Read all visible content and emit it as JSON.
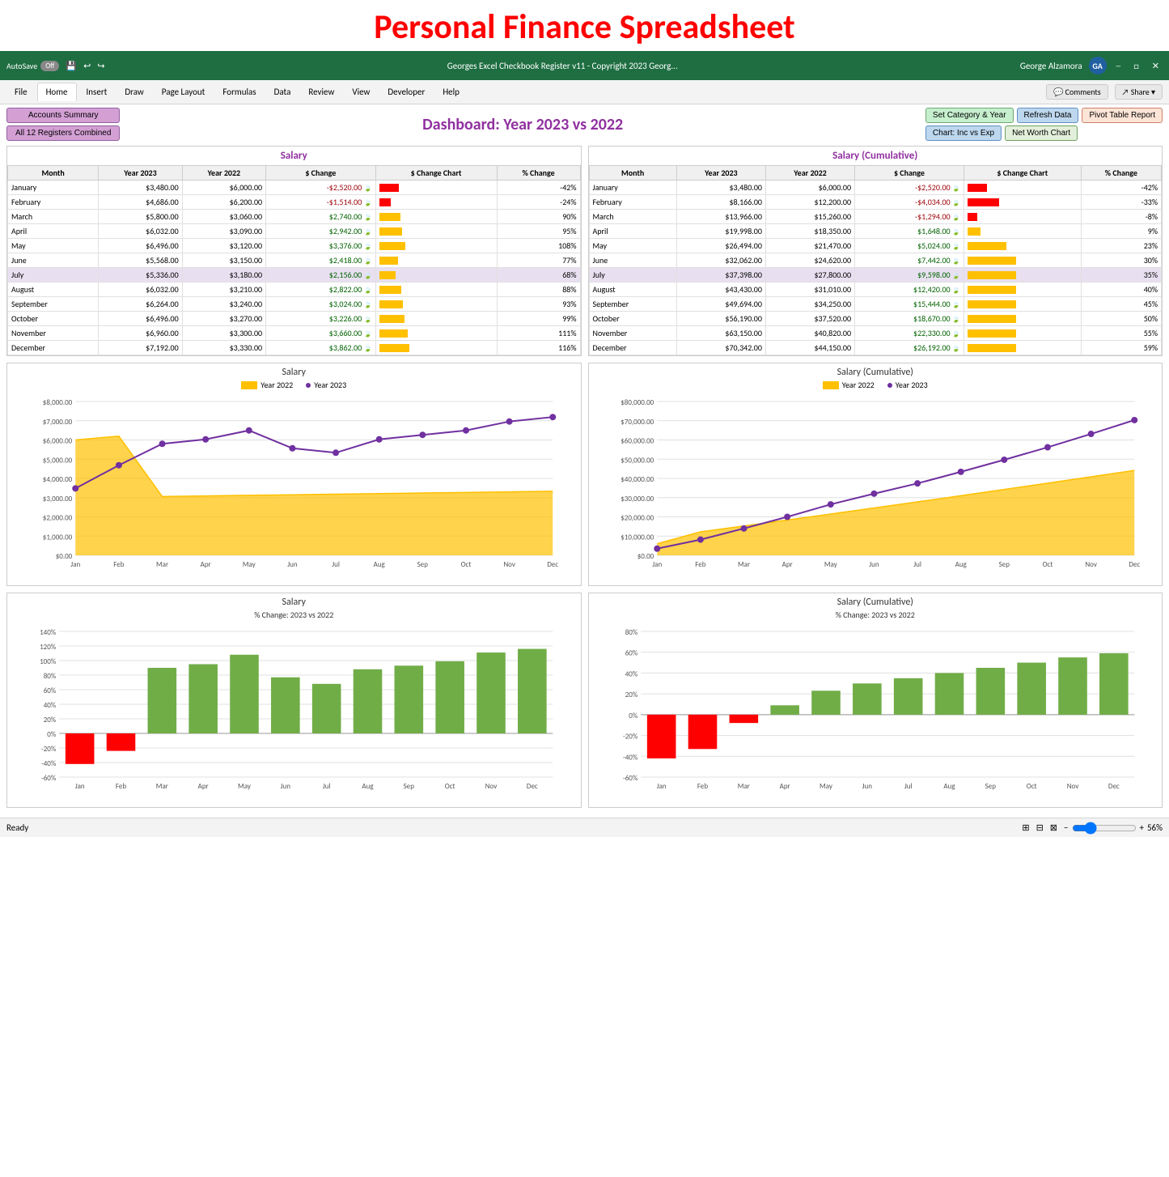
{
  "page": {
    "title": "Personal Finance Spreadsheet"
  },
  "excel": {
    "autosave_label": "AutoSave",
    "autosave_state": "Off",
    "file_title": "Georges Excel Checkbook Register v11 - Copyright 2023 Georg...",
    "user": "George Alzamora",
    "user_initials": "GA"
  },
  "ribbon": {
    "tabs": [
      "File",
      "Home",
      "Insert",
      "Draw",
      "Page Layout",
      "Formulas",
      "Data",
      "Review",
      "View",
      "Developer",
      "Help"
    ],
    "active_tab": "Home",
    "comments_label": "Comments",
    "share_label": "Share"
  },
  "dashboard": {
    "title": "Dashboard: Year 2023 vs 2022",
    "btn_accounts": "Accounts Summary",
    "btn_registers": "All 12 Registers Combined",
    "btn_set_category": "Set Category & Year",
    "btn_refresh": "Refresh Data",
    "btn_pivot": "Pivot Table Report",
    "btn_chart_inc": "Chart: Inc vs Exp",
    "btn_net_worth": "Net Worth Chart"
  },
  "salary_table": {
    "title": "Salary",
    "headers": [
      "Month",
      "Year 2023",
      "Year 2022",
      "$ Change",
      "$ Change Chart",
      "% Change"
    ],
    "rows": [
      {
        "month": "January",
        "y2023": "$3,480.00",
        "y2022": "$6,000.00",
        "change": "-$2,520.00",
        "pct": "-42%",
        "is_neg": true,
        "highlight": false
      },
      {
        "month": "February",
        "y2023": "$4,686.00",
        "y2022": "$6,200.00",
        "change": "-$1,514.00",
        "pct": "-24%",
        "is_neg": true,
        "highlight": false
      },
      {
        "month": "March",
        "y2023": "$5,800.00",
        "y2022": "$3,060.00",
        "change": "$2,740.00",
        "pct": "90%",
        "is_neg": false,
        "highlight": false
      },
      {
        "month": "April",
        "y2023": "$6,032.00",
        "y2022": "$3,090.00",
        "change": "$2,942.00",
        "pct": "95%",
        "is_neg": false,
        "highlight": false
      },
      {
        "month": "May",
        "y2023": "$6,496.00",
        "y2022": "$3,120.00",
        "change": "$3,376.00",
        "pct": "108%",
        "is_neg": false,
        "highlight": false
      },
      {
        "month": "June",
        "y2023": "$5,568.00",
        "y2022": "$3,150.00",
        "change": "$2,418.00",
        "pct": "77%",
        "is_neg": false,
        "highlight": false
      },
      {
        "month": "July",
        "y2023": "$5,336.00",
        "y2022": "$3,180.00",
        "change": "$2,156.00",
        "pct": "68%",
        "is_neg": false,
        "highlight": true
      },
      {
        "month": "August",
        "y2023": "$6,032.00",
        "y2022": "$3,210.00",
        "change": "$2,822.00",
        "pct": "88%",
        "is_neg": false,
        "highlight": false
      },
      {
        "month": "September",
        "y2023": "$6,264.00",
        "y2022": "$3,240.00",
        "change": "$3,024.00",
        "pct": "93%",
        "is_neg": false,
        "highlight": false
      },
      {
        "month": "October",
        "y2023": "$6,496.00",
        "y2022": "$3,270.00",
        "change": "$3,226.00",
        "pct": "99%",
        "is_neg": false,
        "highlight": false
      },
      {
        "month": "November",
        "y2023": "$6,960.00",
        "y2022": "$3,300.00",
        "change": "$3,660.00",
        "pct": "111%",
        "is_neg": false,
        "highlight": false
      },
      {
        "month": "December",
        "y2023": "$7,192.00",
        "y2022": "$3,330.00",
        "change": "$3,862.00",
        "pct": "116%",
        "is_neg": false,
        "highlight": false
      }
    ]
  },
  "salary_cumulative_table": {
    "title": "Salary (Cumulative)",
    "headers": [
      "Month",
      "Year 2023",
      "Year 2022",
      "$ Change",
      "$ Change Chart",
      "% Change"
    ],
    "rows": [
      {
        "month": "January",
        "y2023": "$3,480.00",
        "y2022": "$6,000.00",
        "change": "-$2,520.00",
        "pct": "-42%",
        "is_neg": true,
        "highlight": false
      },
      {
        "month": "February",
        "y2023": "$8,166.00",
        "y2022": "$12,200.00",
        "change": "-$4,034.00",
        "pct": "-33%",
        "is_neg": true,
        "highlight": false
      },
      {
        "month": "March",
        "y2023": "$13,966.00",
        "y2022": "$15,260.00",
        "change": "-$1,294.00",
        "pct": "-8%",
        "is_neg": true,
        "highlight": false
      },
      {
        "month": "April",
        "y2023": "$19,998.00",
        "y2022": "$18,350.00",
        "change": "$1,648.00",
        "pct": "9%",
        "is_neg": false,
        "highlight": false
      },
      {
        "month": "May",
        "y2023": "$26,494.00",
        "y2022": "$21,470.00",
        "change": "$5,024.00",
        "pct": "23%",
        "is_neg": false,
        "highlight": false
      },
      {
        "month": "June",
        "y2023": "$32,062.00",
        "y2022": "$24,620.00",
        "change": "$7,442.00",
        "pct": "30%",
        "is_neg": false,
        "highlight": false
      },
      {
        "month": "July",
        "y2023": "$37,398.00",
        "y2022": "$27,800.00",
        "change": "$9,598.00",
        "pct": "35%",
        "is_neg": false,
        "highlight": true
      },
      {
        "month": "August",
        "y2023": "$43,430.00",
        "y2022": "$31,010.00",
        "change": "$12,420.00",
        "pct": "40%",
        "is_neg": false,
        "highlight": false
      },
      {
        "month": "September",
        "y2023": "$49,694.00",
        "y2022": "$34,250.00",
        "change": "$15,444.00",
        "pct": "45%",
        "is_neg": false,
        "highlight": false
      },
      {
        "month": "October",
        "y2023": "$56,190.00",
        "y2022": "$37,520.00",
        "change": "$18,670.00",
        "pct": "50%",
        "is_neg": false,
        "highlight": false
      },
      {
        "month": "November",
        "y2023": "$63,150.00",
        "y2022": "$40,820.00",
        "change": "$22,330.00",
        "pct": "55%",
        "is_neg": false,
        "highlight": false
      },
      {
        "month": "December",
        "y2023": "$70,342.00",
        "y2022": "$44,150.00",
        "change": "$26,192.00",
        "pct": "59%",
        "is_neg": false,
        "highlight": false
      }
    ]
  },
  "chart1": {
    "title": "Salary",
    "legend_yellow": "Year 2022",
    "legend_purple": "Year 2023",
    "y_labels": [
      "$8,000.00",
      "$7,000.00",
      "$6,000.00",
      "$5,000.00",
      "$4,000.00",
      "$3,000.00",
      "$2,000.00",
      "$1,000.00",
      "$0.00"
    ],
    "x_labels": [
      "Jan",
      "Feb",
      "Mar",
      "Apr",
      "May",
      "Jun",
      "Jul",
      "Aug",
      "Sep",
      "Oct",
      "Nov",
      "Dec"
    ],
    "y2022_values": [
      6000,
      6200,
      3060,
      3090,
      3120,
      3150,
      3180,
      3210,
      3240,
      3270,
      3300,
      3330
    ],
    "y2023_values": [
      3480,
      4686,
      5800,
      6032,
      6496,
      5568,
      5336,
      6032,
      6264,
      6496,
      6960,
      7192
    ]
  },
  "chart2": {
    "title": "Salary (Cumulative)",
    "legend_yellow": "Year 2022",
    "legend_purple": "Year 2023",
    "y_labels": [
      "$80,000.00",
      "$70,000.00",
      "$60,000.00",
      "$50,000.00",
      "$40,000.00",
      "$30,000.00",
      "$20,000.00",
      "$10,000.00",
      "$0.00"
    ],
    "x_labels": [
      "Jan",
      "Feb",
      "Mar",
      "Apr",
      "May",
      "Jun",
      "Jul",
      "Aug",
      "Sep",
      "Oct",
      "Nov",
      "Dec"
    ],
    "y2022_values": [
      6000,
      12200,
      15260,
      18350,
      21470,
      24620,
      27800,
      31010,
      34250,
      37520,
      40820,
      44150
    ],
    "y2023_values": [
      3480,
      8166,
      13966,
      19998,
      26494,
      32062,
      37398,
      43430,
      49694,
      56190,
      63150,
      70342
    ]
  },
  "chart3": {
    "title": "Salary",
    "subtitle": "% Change: 2023 vs 2022",
    "y_labels": [
      "140%",
      "120%",
      "100%",
      "80%",
      "60%",
      "40%",
      "20%",
      "0%",
      "-20%",
      "-40%",
      "-60%"
    ],
    "x_labels": [
      "Jan",
      "Feb",
      "Mar",
      "Apr",
      "May",
      "Jun",
      "Jul",
      "Aug",
      "Sep",
      "Oct",
      "Nov",
      "Dec"
    ],
    "values": [
      -42,
      -24,
      90,
      95,
      108,
      77,
      68,
      88,
      93,
      99,
      111,
      116
    ]
  },
  "chart4": {
    "title": "Salary (Cumulative)",
    "subtitle": "% Change: 2023 vs 2022",
    "y_labels": [
      "80%",
      "60%",
      "40%",
      "20%",
      "0%",
      "-20%",
      "-40%",
      "-60%"
    ],
    "x_labels": [
      "Jan",
      "Feb",
      "Mar",
      "Apr",
      "May",
      "Jun",
      "Jul",
      "Aug",
      "Sep",
      "Oct",
      "Nov",
      "Dec"
    ],
    "values": [
      -42,
      -33,
      -8,
      9,
      23,
      30,
      35,
      40,
      45,
      50,
      55,
      59
    ]
  },
  "status": {
    "ready": "Ready",
    "zoom": "56%"
  }
}
